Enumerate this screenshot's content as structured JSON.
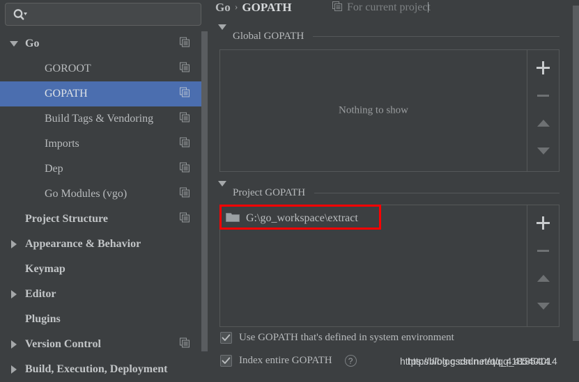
{
  "search": {
    "placeholder": "",
    "value": "",
    "icon": "search-icon"
  },
  "sidebar": {
    "items": [
      {
        "label": "Go",
        "level": 0,
        "bold": true,
        "arrow": "down",
        "copy": true,
        "selected": false
      },
      {
        "label": "GOROOT",
        "level": 1,
        "bold": false,
        "arrow": "none",
        "copy": true,
        "selected": false
      },
      {
        "label": "GOPATH",
        "level": 1,
        "bold": false,
        "arrow": "none",
        "copy": true,
        "selected": true
      },
      {
        "label": "Build Tags & Vendoring",
        "level": 1,
        "bold": false,
        "arrow": "none",
        "copy": true,
        "selected": false
      },
      {
        "label": "Imports",
        "level": 1,
        "bold": false,
        "arrow": "none",
        "copy": true,
        "selected": false
      },
      {
        "label": "Dep",
        "level": 1,
        "bold": false,
        "arrow": "none",
        "copy": true,
        "selected": false
      },
      {
        "label": "Go Modules (vgo)",
        "level": 1,
        "bold": false,
        "arrow": "none",
        "copy": true,
        "selected": false
      },
      {
        "label": "Project Structure",
        "level": 0,
        "bold": true,
        "arrow": "none",
        "copy": true,
        "selected": false
      },
      {
        "label": "Appearance & Behavior",
        "level": 0,
        "bold": true,
        "arrow": "right",
        "copy": false,
        "selected": false
      },
      {
        "label": "Keymap",
        "level": 0,
        "bold": true,
        "arrow": "none",
        "copy": false,
        "selected": false
      },
      {
        "label": "Editor",
        "level": 0,
        "bold": true,
        "arrow": "right",
        "copy": false,
        "selected": false
      },
      {
        "label": "Plugins",
        "level": 0,
        "bold": true,
        "arrow": "none",
        "copy": false,
        "selected": false
      },
      {
        "label": "Version Control",
        "level": 0,
        "bold": true,
        "arrow": "right",
        "copy": true,
        "selected": false
      },
      {
        "label": "Build, Execution, Deployment",
        "level": 0,
        "bold": true,
        "arrow": "right",
        "copy": false,
        "selected": false
      }
    ]
  },
  "header": {
    "breadcrumb_root": "Go",
    "breadcrumb_sep": "›",
    "breadcrumb_current": "GOPATH",
    "scope_label": "For current project",
    "scope_icon": "copy-settings-icon"
  },
  "global_gopath": {
    "title": "Global GOPATH",
    "empty_message": "Nothing to show",
    "buttons": {
      "add": "+",
      "remove": "−",
      "move_up": "▲",
      "move_down": "▼"
    }
  },
  "project_gopath": {
    "title": "Project GOPATH",
    "entries": [
      {
        "path": "G:\\go_workspace\\extract",
        "icon": "folder-icon",
        "highlighted": true
      }
    ],
    "buttons": {
      "add": "+",
      "remove": "−",
      "move_up": "▲",
      "move_down": "▼"
    }
  },
  "options": [
    {
      "label": "Use GOPATH that's defined in system environment",
      "checked": true,
      "help": false
    },
    {
      "label": "Index entire GOPATH",
      "checked": true,
      "help": true,
      "help_glyph": "?"
    }
  ],
  "watermark": {
    "line_a": "https://blog.csdn.net/qq_41854014",
    "line_b": "https://blog.csdn.net/qq_41854014"
  },
  "colors": {
    "background": "#3c3f41",
    "selection_blue": "#4b6eaf",
    "highlight_red": "#fe0000",
    "text": "#b8bbbd",
    "muted_text": "#8a8d8f",
    "border": "#555859",
    "scrollbar": "#5a5d60"
  }
}
